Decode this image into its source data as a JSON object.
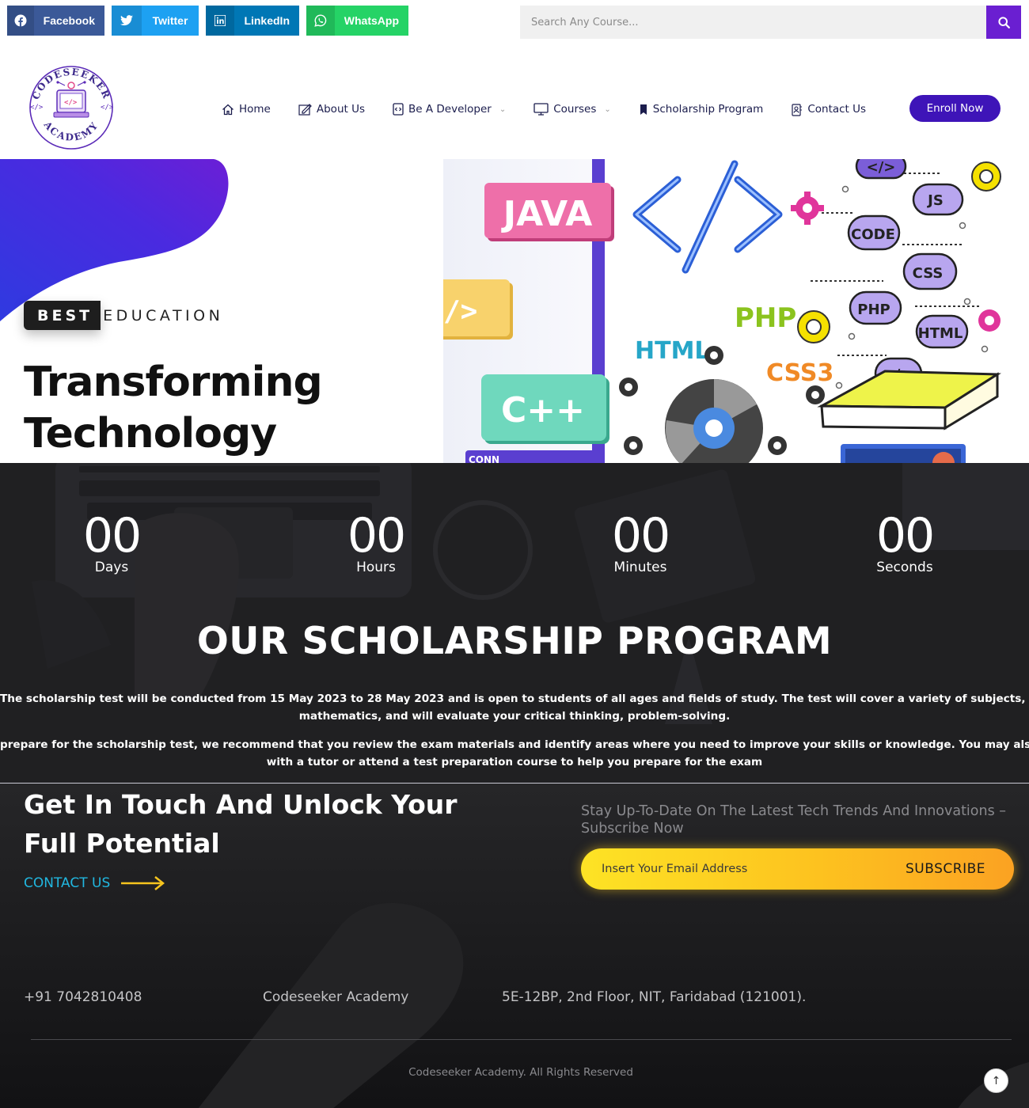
{
  "share": {
    "facebook": "Facebook",
    "twitter": "Twitter",
    "linkedin": "LinkedIn",
    "whatsapp": "WhatsApp"
  },
  "search": {
    "placeholder": "Search Any Course..."
  },
  "logo": {
    "top_text": "CODESEEKER",
    "bottom_text": "ACADEMY"
  },
  "nav": {
    "home": "Home",
    "about": "About Us",
    "developer": "Be A Developer",
    "courses": "Courses",
    "scholarship": "Scholarship Program",
    "contact": "Contact Us"
  },
  "enroll_label": "Enroll Now",
  "hero": {
    "badge_best": "BEST",
    "badge_rest": "EDUCATION",
    "title_line1": "Transforming",
    "title_line2": "Technology",
    "illustration_labels": [
      "JAVA",
      "C++",
      "PHP",
      "HTML",
      "CSS3",
      "JS",
      "CODE",
      "CSS",
      "PHP",
      "HTML",
      "</>",
      "</>",
      "CONN"
    ]
  },
  "countdown": [
    {
      "value": "00",
      "label": "Days"
    },
    {
      "value": "00",
      "label": "Hours"
    },
    {
      "value": "00",
      "label": "Minutes"
    },
    {
      "value": "00",
      "label": "Seconds"
    }
  ],
  "scholarship": {
    "title": "OUR SCHOLARSHIP PROGRAM",
    "p1_line1": "The scholarship test will be conducted from 15 May 2023 to 28 May 2023 and is open to students of all ages and fields of study. The test will cover a variety of subjects, including",
    "p1_line2": "mathematics, and will evaluate your critical thinking, problem-solving.",
    "p2_line1": "prepare for the scholarship test, we recommend that you review the exam materials and identify areas where you need to improve your skills or knowledge. You may also want to work",
    "p2_line2": "with a tutor or attend a test preparation course to help you prepare for the exam"
  },
  "footer": {
    "title": "Get In Touch And Unlock Your Full Potential",
    "contact_label": "CONTACT US",
    "subscribe_text": "Stay Up-To-Date On The Latest Tech Trends And Innovations – Subscribe Now",
    "email_placeholder": "Insert Your Email Address",
    "subscribe_label": "SUBSCRIBE",
    "phone": "+91 7042810408",
    "name": "Codeseeker Academy",
    "address": "5E-12BP, 2nd Floor, NIT, Faridabad (121001).",
    "copyright": "Codeseeker Academy. All Rights Reserved",
    "to_top": "↑"
  },
  "colors": {
    "brand_purple": "#6a1fd1",
    "enroll_blue": "#3e14b8",
    "contact_cyan": "#21b7e0",
    "subscribe_yellow": "#fdc21f"
  }
}
